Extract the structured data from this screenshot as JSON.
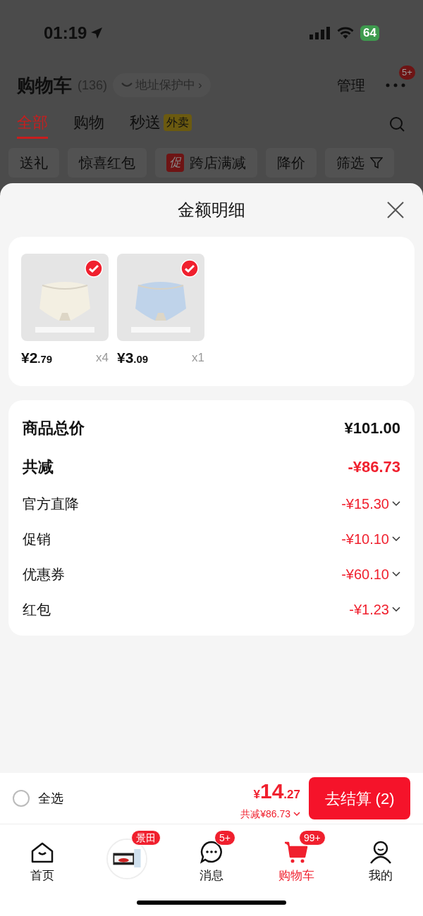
{
  "status_bar": {
    "time": "01:19",
    "battery": "64"
  },
  "header": {
    "title": "购物车",
    "count": "(136)",
    "address_badge": "地址保护中",
    "address_chevron": "›",
    "manage": "管理",
    "more_badge": "5+"
  },
  "tabs": [
    {
      "label": "全部",
      "selected": true
    },
    {
      "label": "购物",
      "selected": false
    },
    {
      "label": "秒送",
      "tag": "外卖",
      "selected": false
    }
  ],
  "filters": [
    {
      "label": "送礼"
    },
    {
      "label": "惊喜红包"
    },
    {
      "label": "跨店满减",
      "tag": "促"
    },
    {
      "label": "降价"
    },
    {
      "label": "筛选",
      "kind": "filter"
    }
  ],
  "sheet": {
    "title": "金额明细",
    "products": [
      {
        "price_int": "¥2",
        "price_dec": ".79",
        "quantity": "x4",
        "checked": true
      },
      {
        "price_int": "¥3",
        "price_dec": ".09",
        "quantity": "x1",
        "checked": true
      }
    ],
    "details": [
      {
        "kind": "total",
        "label": "商品总价",
        "value": "¥101.00"
      },
      {
        "kind": "saving",
        "label": "共减",
        "value": "-¥86.73"
      },
      {
        "kind": "discount",
        "label": "官方直降",
        "value": "-¥15.30"
      },
      {
        "kind": "discount",
        "label": "促销",
        "value": "-¥10.10"
      },
      {
        "kind": "discount",
        "label": "优惠券",
        "value": "-¥60.10"
      },
      {
        "kind": "discount",
        "label": "红包",
        "value": "-¥1.23"
      }
    ]
  },
  "checkout": {
    "select_all": {
      "label": "全选",
      "checked": false
    },
    "currency": "¥",
    "price_int": "14",
    "price_dec": ".27",
    "saving": "共减¥86.73",
    "button": "去结算 (2)"
  },
  "nav": [
    {
      "kind": "home",
      "label": "首页",
      "selected": false
    },
    {
      "kind": "promo",
      "badge": "景田",
      "selected": false
    },
    {
      "kind": "message",
      "label": "消息",
      "badge": "5+",
      "selected": false
    },
    {
      "kind": "cart",
      "label": "购物车",
      "badge": "99+",
      "selected": true
    },
    {
      "kind": "me",
      "label": "我的",
      "selected": false
    }
  ]
}
